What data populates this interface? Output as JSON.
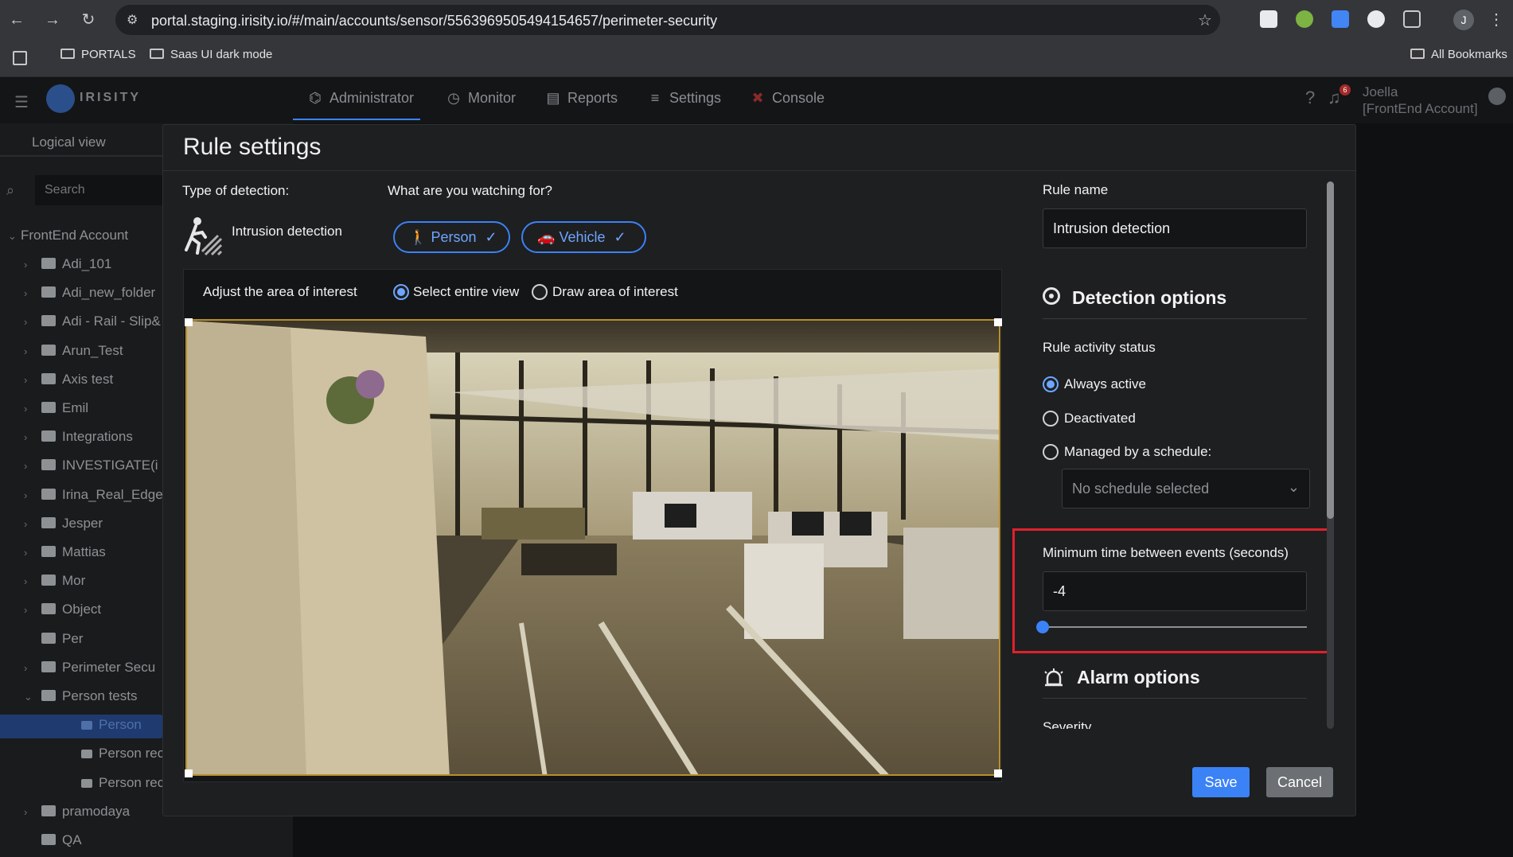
{
  "browser": {
    "url": "portal.staging.irisity.io/#/main/accounts/sensor/5563969505494154657/perimeter-security",
    "bookmarks": [
      "PORTALS",
      "Saas UI dark mode"
    ],
    "all_bookmarks": "All Bookmarks",
    "profile_initial": "J"
  },
  "app": {
    "brand": "IRISITY",
    "menu": [
      {
        "label": "Administrator",
        "icon": "sitemap-icon"
      },
      {
        "label": "Monitor",
        "icon": "clock-icon"
      },
      {
        "label": "Reports",
        "icon": "reports-icon"
      },
      {
        "label": "Settings",
        "icon": "sliders-icon"
      },
      {
        "label": "Console",
        "icon": "console-icon"
      }
    ],
    "notification_count": "6",
    "user_name": "Joella",
    "user_account": "[FrontEnd Account]"
  },
  "sidebar": {
    "tab": "Logical view",
    "search_placeholder": "Search",
    "root": "FrontEnd Account",
    "items": [
      "Adi_101",
      "Adi_new_folder",
      "Adi - Rail - Slip&",
      "Arun_Test",
      "Axis test",
      "Emil",
      "Integrations",
      "INVESTIGATE(i",
      "Irina_Real_Edge",
      "Jesper",
      "Mattias",
      "Mor",
      "Object",
      "Per",
      "Perimeter Secu",
      "Person tests",
      "Person",
      "Person reco",
      "Person rec te",
      "pramodaya",
      "QA"
    ]
  },
  "modal": {
    "title": "Rule settings",
    "type_label": "Type of detection:",
    "detection_type": "Intrusion detection",
    "watching_label": "What are you watching for?",
    "chips": [
      "Person",
      "Vehicle"
    ],
    "area_label": "Adjust the area of interest",
    "area_options": [
      "Select entire view",
      "Draw area of interest"
    ],
    "area_selected": "Select entire view",
    "rule_name_label": "Rule name",
    "rule_name_value": "Intrusion detection",
    "detection_options_title": "Detection options",
    "activity_label": "Rule activity status",
    "activity_options": [
      "Always active",
      "Deactivated",
      "Managed by a schedule:"
    ],
    "activity_selected": "Always active",
    "schedule_placeholder": "No schedule selected",
    "min_time_label": "Minimum time between events (seconds)",
    "min_time_value": "-4",
    "alarm_options_title": "Alarm options",
    "severity_label": "Severity",
    "save_label": "Save",
    "cancel_label": "Cancel"
  },
  "colors": {
    "accent": "#3b82f6",
    "highlight": "#e0212b",
    "selection": "#1f3a6e"
  }
}
